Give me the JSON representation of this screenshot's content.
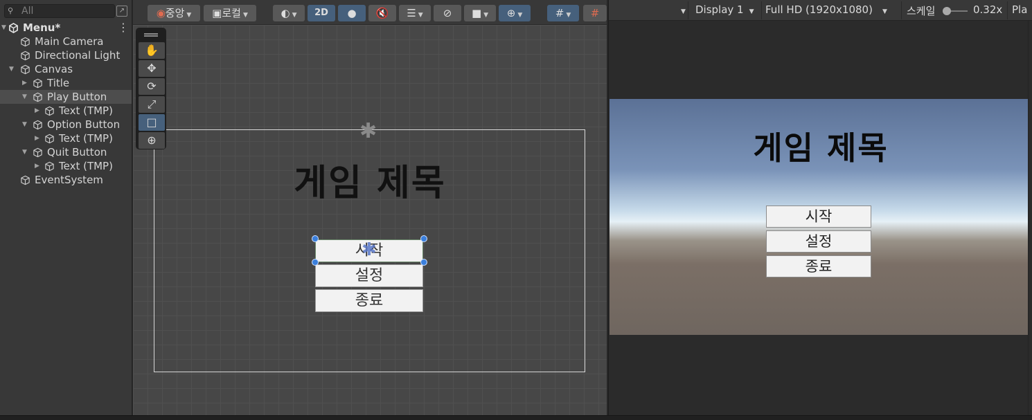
{
  "hierarchy": {
    "search_placeholder": "All",
    "scene_name": "Menu*",
    "items": [
      {
        "label": "Main Camera"
      },
      {
        "label": "Directional Light"
      },
      {
        "label": "Canvas"
      },
      {
        "label": "Title"
      },
      {
        "label": "Play Button"
      },
      {
        "label": "Text (TMP)"
      },
      {
        "label": "Option Button"
      },
      {
        "label": "Text (TMP)"
      },
      {
        "label": "Quit Button"
      },
      {
        "label": "Text (TMP)"
      },
      {
        "label": "EventSystem"
      }
    ]
  },
  "scene_toolbar": {
    "pivot_label": "중앙",
    "space_label": "로컬",
    "mode_2d_label": "2D"
  },
  "scene": {
    "title": "게임 제목",
    "buttons": [
      "시작",
      "설정",
      "종료"
    ]
  },
  "game_toolbar": {
    "display_label": "Display 1",
    "resolution_label": "Full HD (1920x1080)",
    "scale_label": "스케일",
    "scale_value": "0.32x",
    "play_label": "Pla"
  },
  "game": {
    "title": "게임 제목",
    "buttons": [
      "시작",
      "설정",
      "종료"
    ]
  },
  "colors": {
    "panel_bg": "#383838",
    "scene_bg": "#474747",
    "selection": "#4d4d4d",
    "active_toggle": "#46607c",
    "handle_blue": "#3a7fdc"
  }
}
